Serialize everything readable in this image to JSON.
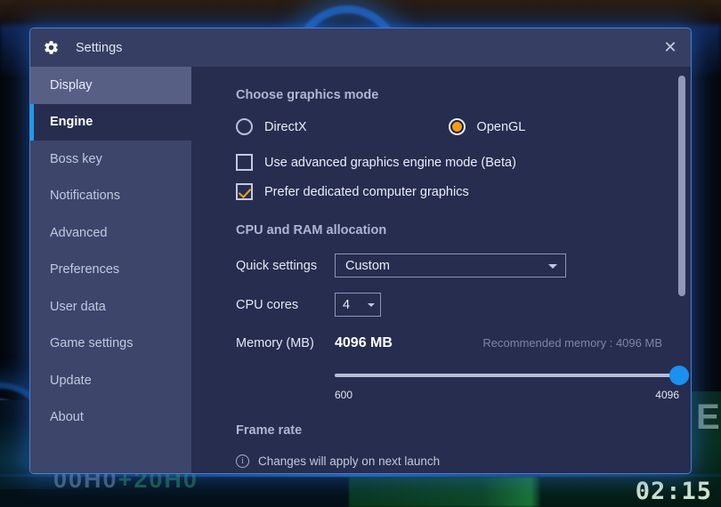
{
  "background": {
    "timer": "02:15",
    "right_text": "ES",
    "faded_text_white": "00H0",
    "faded_text_green": "+20H0"
  },
  "dialog": {
    "title": "Settings",
    "gear_icon": "gear-icon",
    "close_label": "✕"
  },
  "sidebar": {
    "items": [
      {
        "label": "Display",
        "state": "hovered"
      },
      {
        "label": "Engine",
        "state": "active"
      },
      {
        "label": "Boss key",
        "state": "normal"
      },
      {
        "label": "Notifications",
        "state": "normal"
      },
      {
        "label": "Advanced",
        "state": "normal"
      },
      {
        "label": "Preferences",
        "state": "normal"
      },
      {
        "label": "User data",
        "state": "normal"
      },
      {
        "label": "Game settings",
        "state": "normal"
      },
      {
        "label": "Update",
        "state": "normal"
      },
      {
        "label": "About",
        "state": "normal"
      }
    ]
  },
  "content": {
    "graphics": {
      "heading": "Choose graphics mode",
      "options": [
        {
          "label": "DirectX",
          "checked": false
        },
        {
          "label": "OpenGL",
          "checked": true
        }
      ],
      "checkboxes": [
        {
          "label": "Use advanced graphics engine mode (Beta)",
          "checked": false
        },
        {
          "label": "Prefer dedicated computer graphics",
          "checked": true
        }
      ]
    },
    "allocation": {
      "heading": "CPU and RAM allocation",
      "quick_settings_label": "Quick settings",
      "quick_settings_value": "Custom",
      "cpu_cores_label": "CPU cores",
      "cpu_cores_value": "4",
      "memory_label": "Memory (MB)",
      "memory_value": "4096 MB",
      "memory_recommended": "Recommended memory : 4096 MB",
      "slider_min": "600",
      "slider_max": "4096"
    },
    "frame_rate": {
      "heading": "Frame rate",
      "note": "Changes will apply on next launch",
      "info_icon_glyph": "i"
    }
  },
  "colors": {
    "accent_blue": "#1b9df0",
    "accent_orange": "#f49b12",
    "dialog_bg": "#262d4e",
    "sidebar_bg": "#3d456b",
    "titlebar_bg": "#363e63"
  }
}
